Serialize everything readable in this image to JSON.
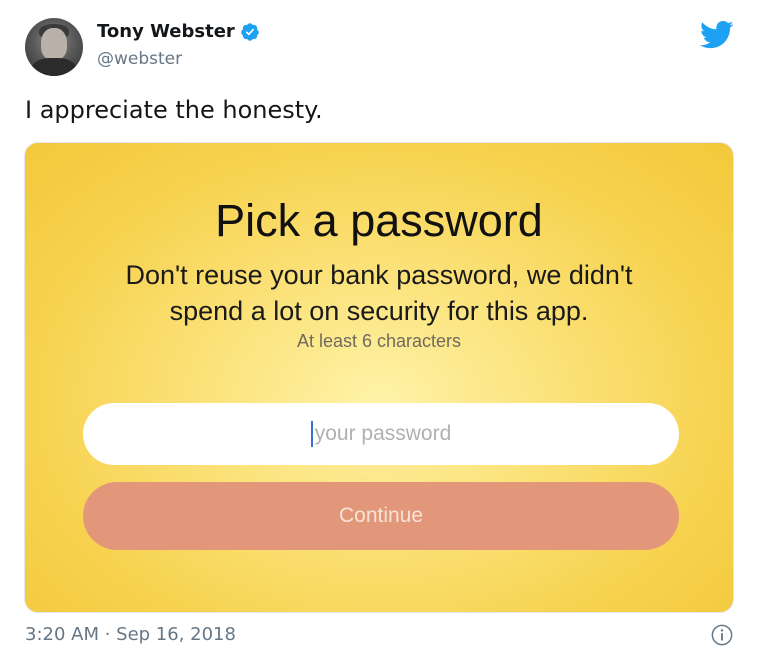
{
  "author": {
    "display_name": "Tony Webster",
    "handle": "@webster",
    "verified": true
  },
  "tweet": {
    "text": "I appreciate the honesty.",
    "timestamp": "3:20 AM · Sep 16, 2018"
  },
  "media": {
    "title": "Pick a password",
    "subtitle_line1": "Don't reuse your bank password, we didn't",
    "subtitle_line2": "spend a lot on security for this app.",
    "hint": "At least 6 characters",
    "password_placeholder": "your password",
    "password_value": "",
    "continue_label": "Continue"
  },
  "icons": {
    "brand": "twitter-bird-icon",
    "verified": "verified-badge-icon",
    "info": "info-icon"
  },
  "colors": {
    "twitter_blue": "#1da1f2",
    "background_yellow": "#f6d24e",
    "button_salmon": "#e3977a"
  }
}
